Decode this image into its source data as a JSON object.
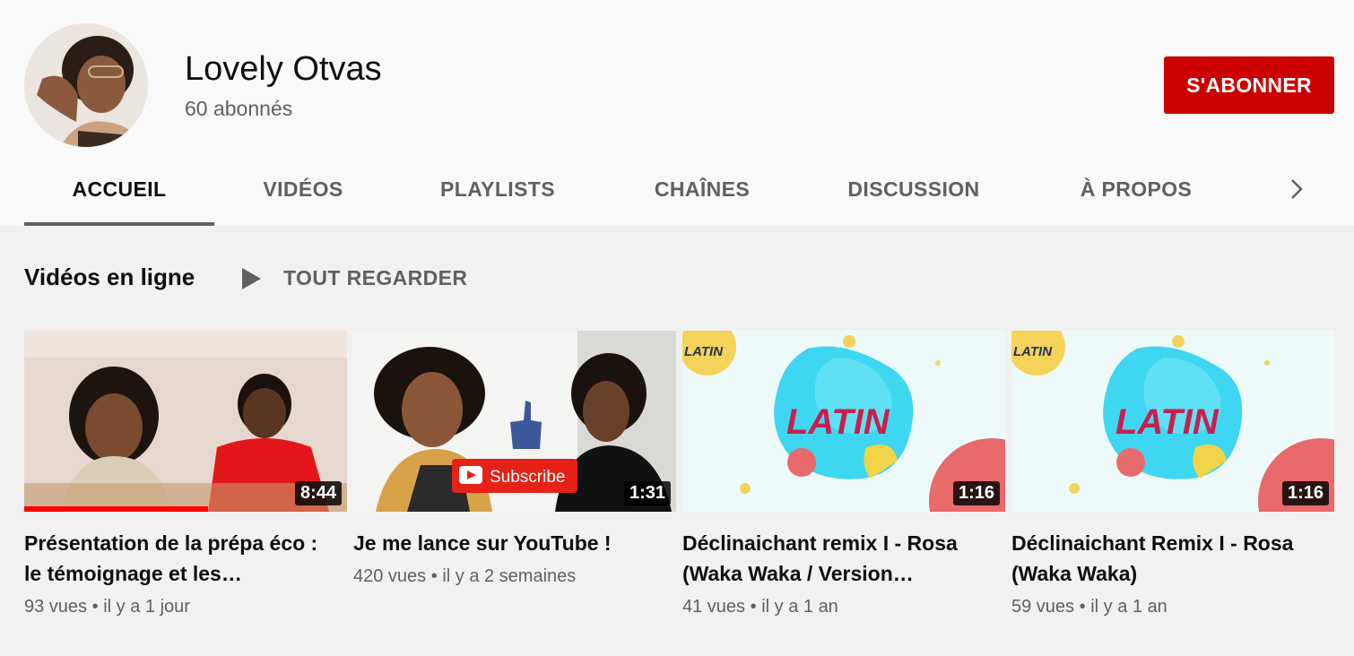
{
  "channel": {
    "name": "Lovely Otvas",
    "subscribers": "60 abonnés",
    "subscribe_label": "S'ABONNER"
  },
  "tabs": [
    {
      "label": "ACCUEIL",
      "active": true
    },
    {
      "label": "VIDÉOS"
    },
    {
      "label": "PLAYLISTS"
    },
    {
      "label": "CHAÎNES"
    },
    {
      "label": "DISCUSSION"
    },
    {
      "label": "À PROPOS"
    }
  ],
  "section": {
    "title": "Vidéos en ligne",
    "play_all_label": "TOUT REGARDER"
  },
  "videos": [
    {
      "title": "Présentation de la prépa éco : le témoignage et les…",
      "views": "93 vues",
      "age": "il y a 1 jour",
      "duration": "8:44",
      "watched_fraction": 0.57
    },
    {
      "title": "Je me lance sur YouTube !",
      "views": "420 vues",
      "age": "il y a 2 semaines",
      "duration": "1:31",
      "overlay_text": "Subscribe"
    },
    {
      "title": "Déclinaichant remix I - Rosa (Waka Waka / Version…",
      "views": "41 vues",
      "age": "il y a 1 an",
      "duration": "1:16",
      "overlay_text": "LATIN",
      "corner_text": "LATIN"
    },
    {
      "title": "Déclinaichant Remix I - Rosa (Waka Waka)",
      "views": "59 vues",
      "age": "il y a 1 an",
      "duration": "1:16",
      "overlay_text": "LATIN",
      "corner_text": "LATIN"
    }
  ],
  "meta_separator": "•",
  "colors": {
    "subscribe_bg": "#cc0000",
    "progress": "#ff0000",
    "latin_blue": "#3ed6f0",
    "latin_text": "#c8204e"
  },
  "icons": [
    "chevron-right-icon",
    "play-icon"
  ]
}
